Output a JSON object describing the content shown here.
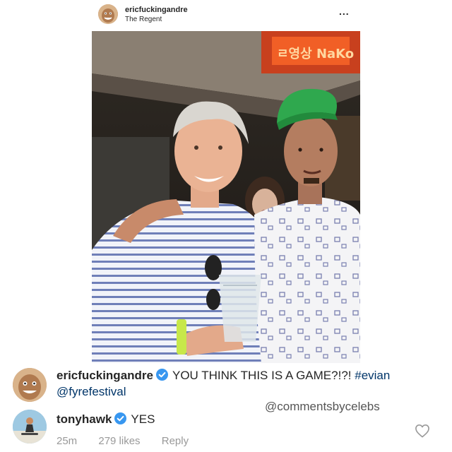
{
  "header": {
    "username": "ericfuckingandre",
    "location": "The Regent",
    "more_label": "..."
  },
  "photo": {
    "sign_text": "ㄹ영상 NaKo",
    "label": "post-photo"
  },
  "caption": {
    "username": "ericfuckingandre",
    "text": "YOU THINK THIS IS A GAME?!?!",
    "hashtag": "#evian",
    "mention": "@fyrefestival"
  },
  "watermark": "@commentsbycelebs",
  "comment": {
    "username": "tonyhawk",
    "text": "YES",
    "time": "25m",
    "likes": "279 likes",
    "reply_label": "Reply"
  },
  "colors": {
    "verified": "#3897f0",
    "link": "#003569",
    "meta": "#999999",
    "text": "#262626"
  },
  "icons": {
    "verified": "verified-badge-icon",
    "heart": "heart-outline-icon",
    "more": "more-options-icon"
  }
}
